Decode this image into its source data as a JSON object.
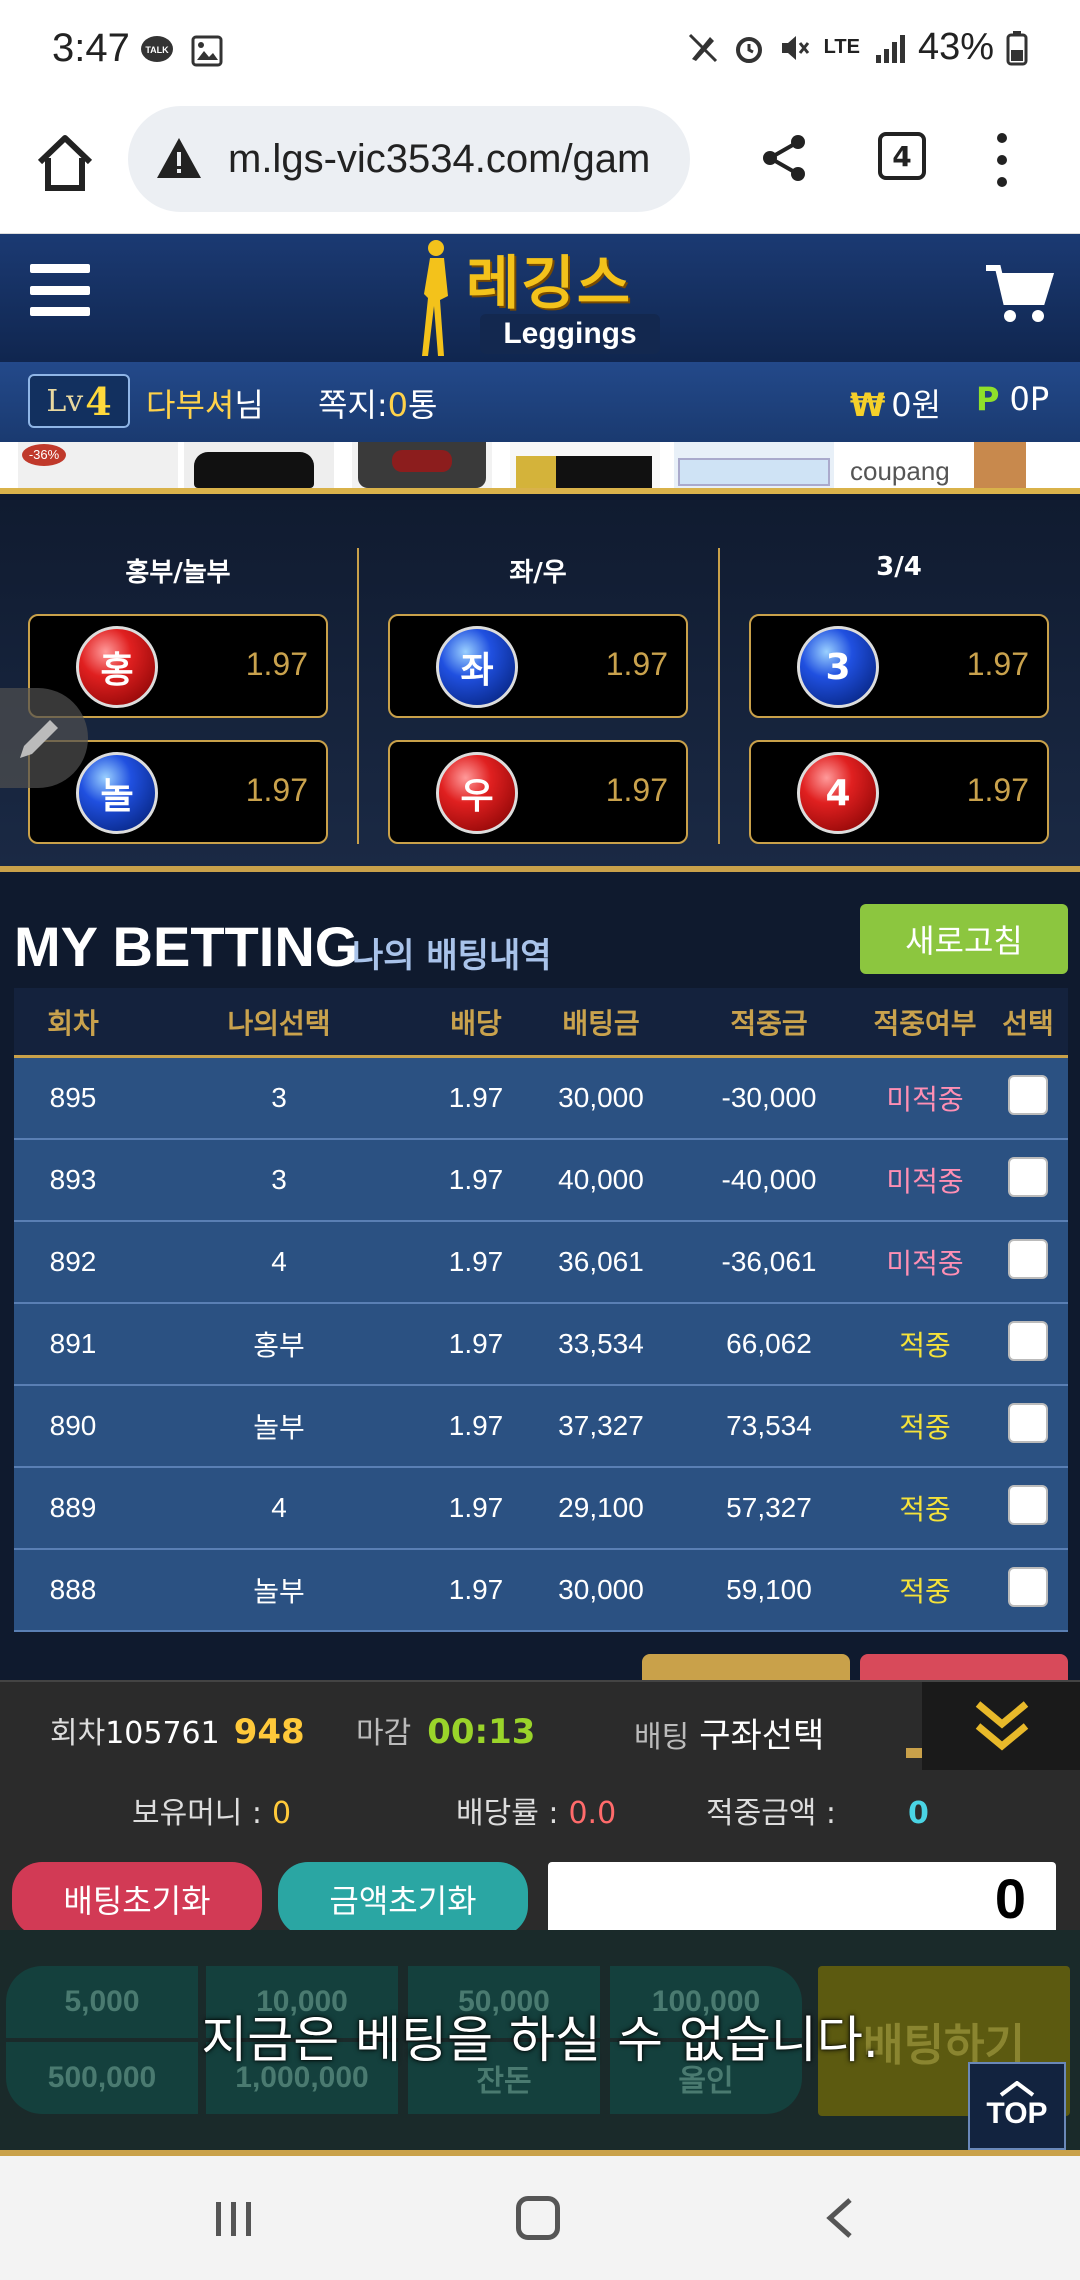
{
  "status_bar": {
    "time": "3:47",
    "battery": "43%",
    "network": "LTE"
  },
  "browser": {
    "url": "m.lgs-vic3534.com/gam",
    "tab_count": "4"
  },
  "site": {
    "logo_korean": "레깅스",
    "logo_english": "Leggings"
  },
  "user": {
    "level_prefix": "Lv",
    "level_num": "4",
    "name": "다부셔",
    "name_suffix": "님",
    "msg_label": "쪽지:",
    "msg_count": "0",
    "msg_unit": "통",
    "money": "0원",
    "money_symbol": "₩",
    "point_symbol": "P",
    "points": "0P"
  },
  "banner": {
    "brand": "coupang"
  },
  "odds": {
    "columns": [
      {
        "header": "홍부/놀부",
        "items": [
          {
            "label": "홍",
            "odd": "1.97",
            "color": "red"
          },
          {
            "label": "놀",
            "odd": "1.97",
            "color": "blue"
          }
        ]
      },
      {
        "header": "좌/우",
        "items": [
          {
            "label": "좌",
            "odd": "1.97",
            "color": "blue"
          },
          {
            "label": "우",
            "odd": "1.97",
            "color": "red"
          }
        ]
      },
      {
        "header": "3/4",
        "items": [
          {
            "label": "3",
            "odd": "1.97",
            "color": "blue"
          },
          {
            "label": "4",
            "odd": "1.97",
            "color": "red"
          }
        ]
      }
    ]
  },
  "my_betting": {
    "title": "MY BETTING",
    "subtitle": "나의 배팅내역",
    "refresh_label": "새로고침",
    "headers": [
      "회차",
      "나의선택",
      "배당",
      "배팅금",
      "적중금",
      "적중여부",
      "선택"
    ],
    "rows": [
      {
        "round": "895",
        "pick": "3",
        "odd": "1.97",
        "bet": "30,000",
        "win": "-30,000",
        "result": "미적중",
        "hit": false
      },
      {
        "round": "893",
        "pick": "3",
        "odd": "1.97",
        "bet": "40,000",
        "win": "-40,000",
        "result": "미적중",
        "hit": false
      },
      {
        "round": "892",
        "pick": "4",
        "odd": "1.97",
        "bet": "36,061",
        "win": "-36,061",
        "result": "미적중",
        "hit": false
      },
      {
        "round": "891",
        "pick": "홍부",
        "odd": "1.97",
        "bet": "33,534",
        "win": "66,062",
        "result": "적중",
        "hit": true
      },
      {
        "round": "890",
        "pick": "놀부",
        "odd": "1.97",
        "bet": "37,327",
        "win": "73,534",
        "result": "적중",
        "hit": true
      },
      {
        "round": "889",
        "pick": "4",
        "odd": "1.97",
        "bet": "29,100",
        "win": "57,327",
        "result": "적중",
        "hit": true
      },
      {
        "round": "888",
        "pick": "놀부",
        "odd": "1.97",
        "bet": "30,000",
        "win": "59,100",
        "result": "적중",
        "hit": true
      }
    ]
  },
  "bet_panel": {
    "round_label": "회차",
    "round_total": "105761",
    "round_current": "948",
    "close_label": "마감",
    "close_time": "00:13",
    "select_label": "배팅",
    "select_value": "구좌선택",
    "hold_label": "보유머니 :",
    "hold_value": "0",
    "rate_label": "배당률 :",
    "rate_value": "0.0",
    "win_label": "적중금액 :",
    "win_value": "0",
    "reset_bet_label": "배팅초기화",
    "reset_amount_label": "금액초기화",
    "amount": "0"
  },
  "chips": [
    "5,000",
    "10,000",
    "50,000",
    "100,000",
    "500,000",
    "1,000,000",
    "잔돈",
    "올인"
  ],
  "bet_button": "배팅하기",
  "overlay_message": "지금은 베팅을 하실 수 없습니다.",
  "top_button": "TOP"
}
